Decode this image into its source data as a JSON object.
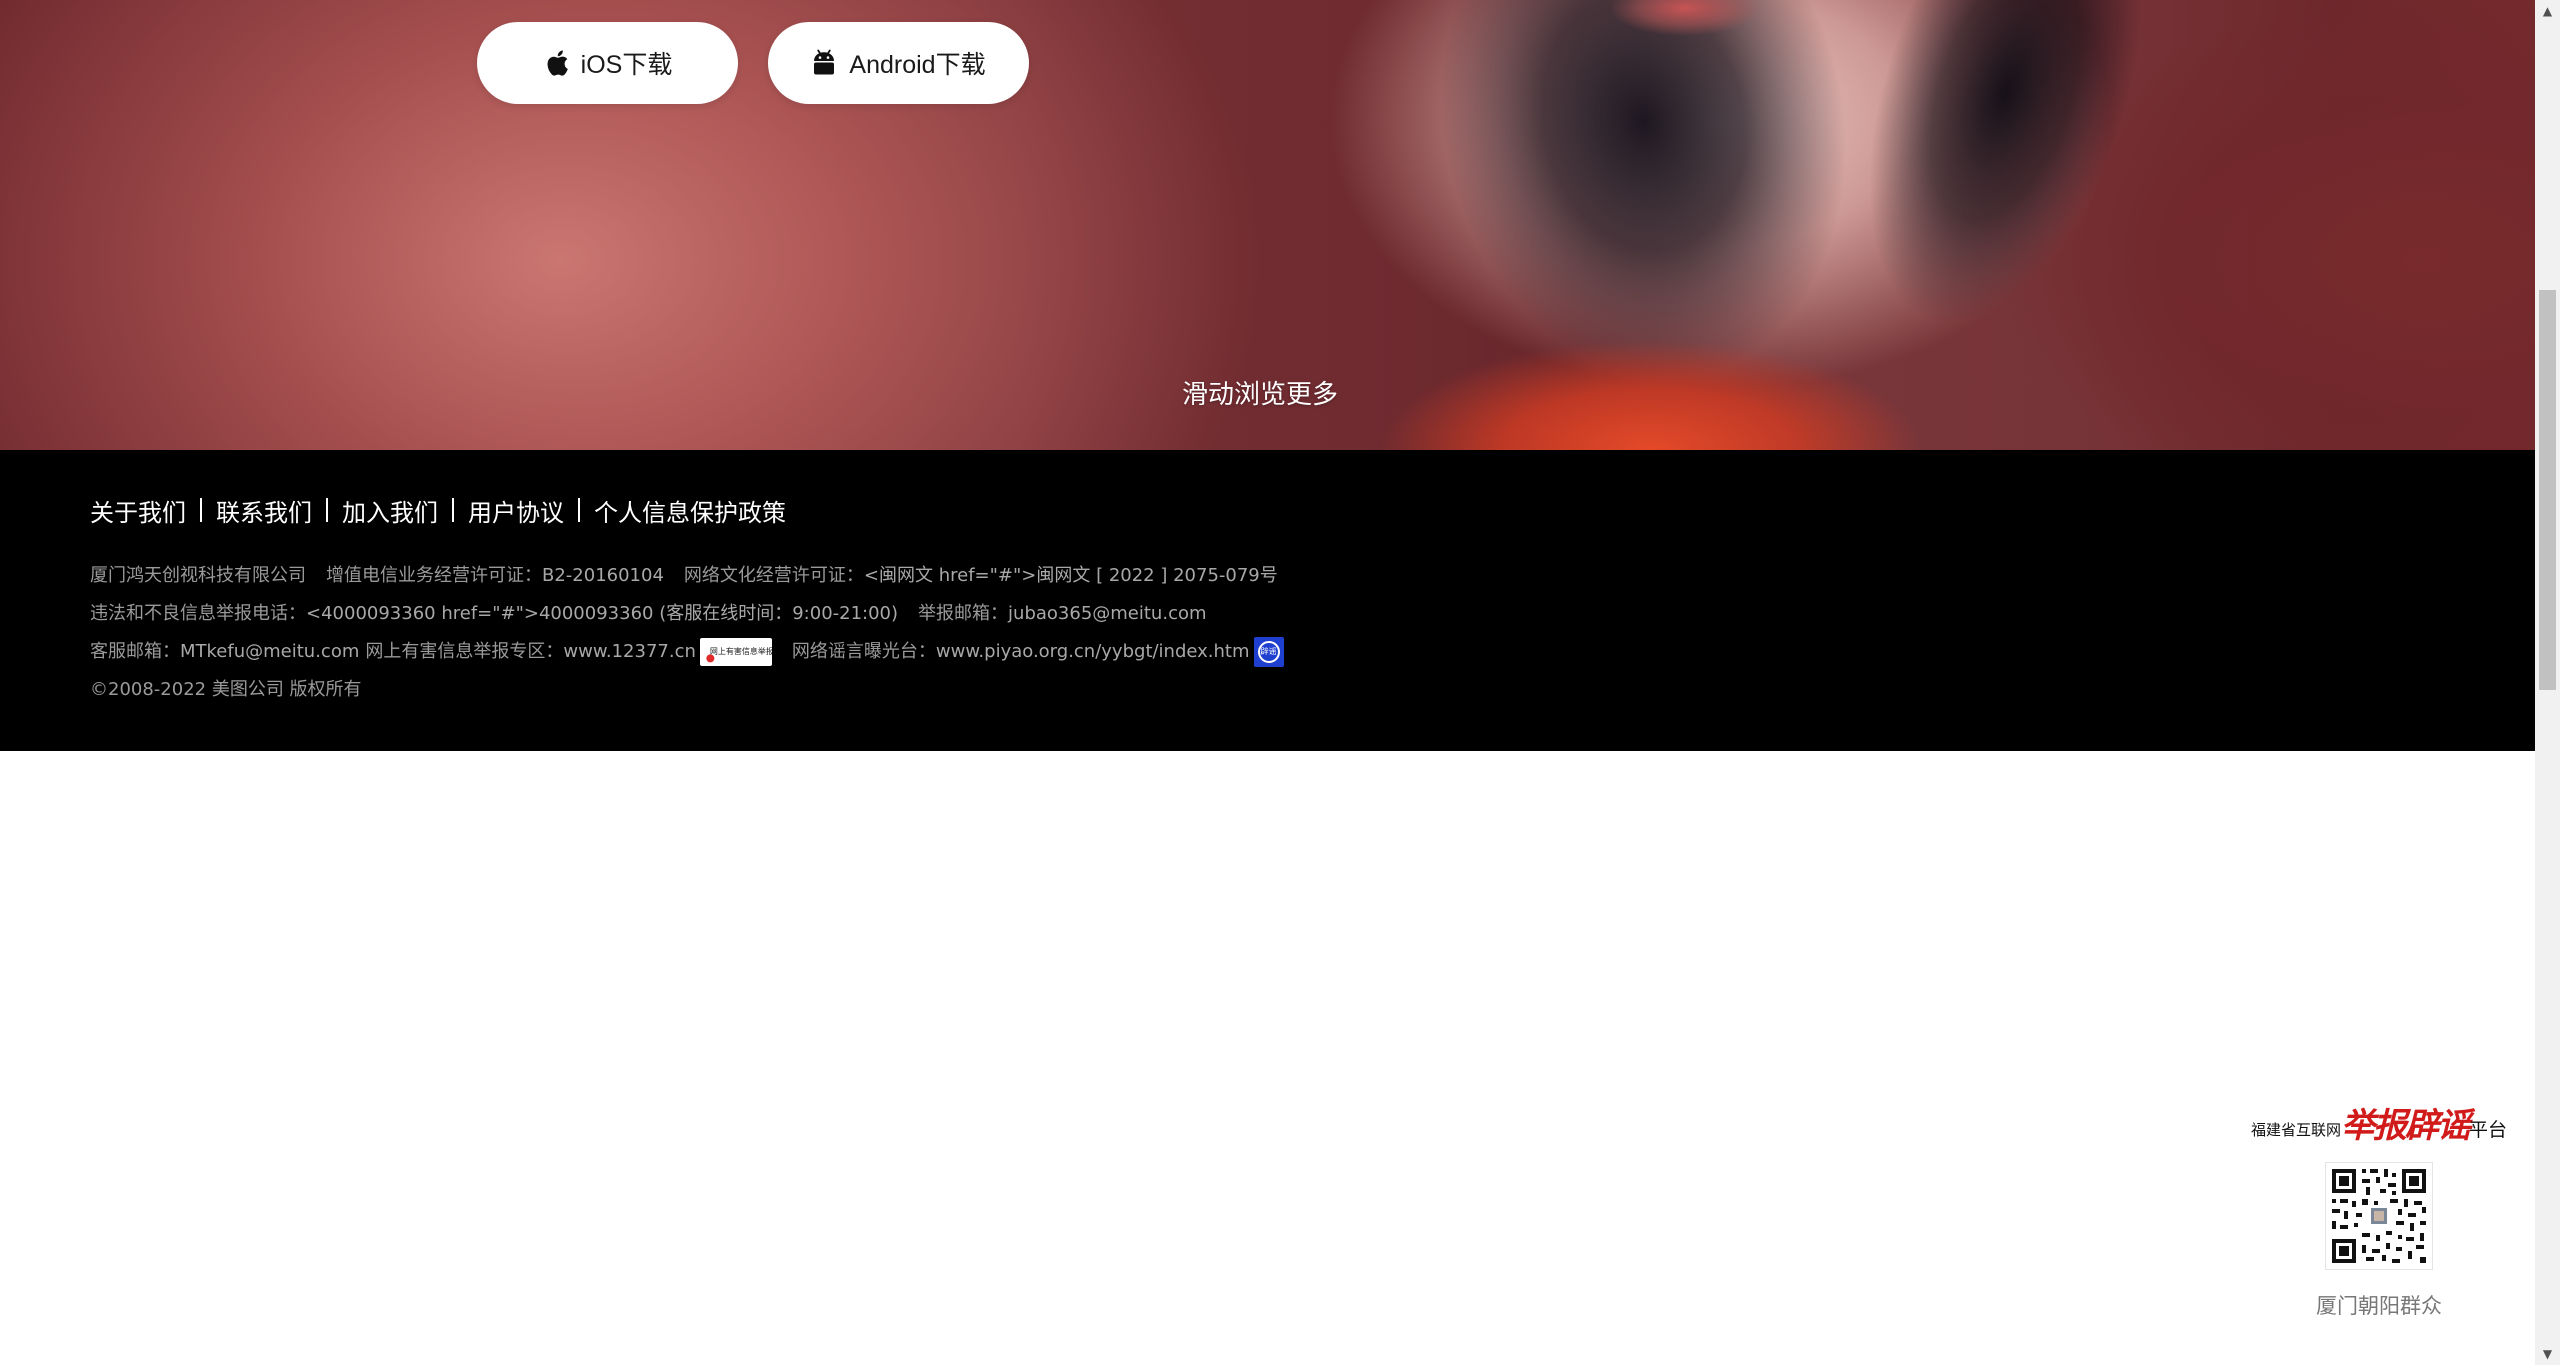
{
  "hero": {
    "ios_button": "iOS下载",
    "android_button": "Android下载",
    "scroll_hint": "滑动浏览更多"
  },
  "footer": {
    "nav": [
      "关于我们",
      "联系我们",
      "加入我们",
      "用户协议",
      "个人信息保护政策"
    ],
    "company": "厦门鸿天创视科技有限公司",
    "icp_label": "增值电信业务经营许可证：",
    "icp_value": "B2-20160104",
    "culture_label": "网络文化经营许可证：",
    "culture_value": "<闽网文 href=\"#\">闽网文 [ 2022 ] 2075-079号",
    "report_phone_label": "违法和不良信息举报电话：",
    "report_phone_value": "<4000093360 href=\"#\">4000093360 (客服在线时间：9:00-21:00)",
    "report_email_label": "举报邮箱：",
    "report_email_value": "jubao365@meitu.com",
    "service_email_label": "客服邮箱：",
    "service_email_value": "MTkefu@meitu.com",
    "harmful_label": "网上有害信息举报专区：",
    "harmful_value": "www.12377.cn",
    "harmful_badge_text": "网上有害信息举报专区",
    "rumor_label": "网络谣言曝光台：",
    "rumor_value": "www.piyao.org.cn/yybgt/index.htm",
    "rumor_badge_text": "辟谣",
    "copyright": "©2008-2022 美图公司 版权所有"
  },
  "report_widget": {
    "logo_prefix": "福建省互联网",
    "logo_main": "举报辟谣",
    "logo_suffix": "平台",
    "caption": "厦门朝阳群众"
  },
  "scrollbar": {
    "up_icon": "▲",
    "down_icon": "▼"
  },
  "colors": {
    "footer_bg": "#000000",
    "footer_text": "#9a9a9a",
    "report_red": "#d11a1a"
  }
}
